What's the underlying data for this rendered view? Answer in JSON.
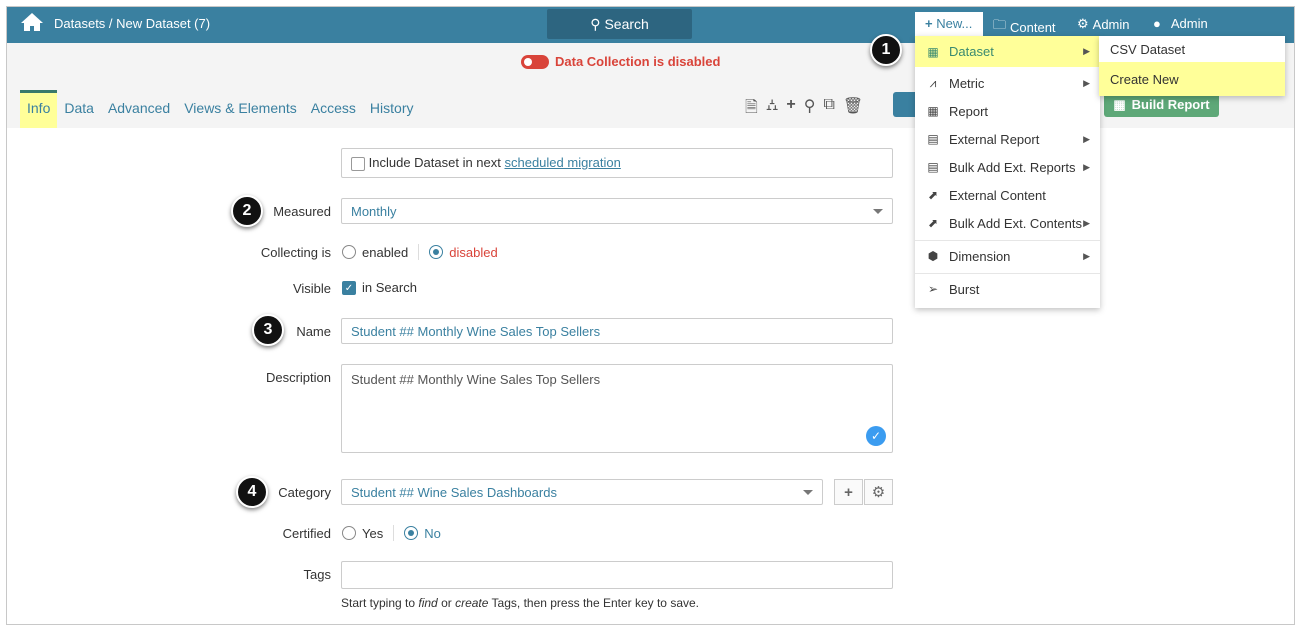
{
  "header": {
    "breadcrumb": "Datasets / New Dataset (7)",
    "search_label": "Search",
    "new_label": "New...",
    "content_label": "Content",
    "admin_label": "Admin",
    "user_label": "Admin"
  },
  "status": {
    "data_collection": "Data Collection is disabled"
  },
  "tabs": [
    {
      "label": "Info"
    },
    {
      "label": "Data"
    },
    {
      "label": "Advanced"
    },
    {
      "label": "Views & Elements"
    },
    {
      "label": "Access"
    },
    {
      "label": "History"
    }
  ],
  "toolbar": {
    "build_report": "Build Report"
  },
  "new_menu": {
    "items": [
      {
        "label": "Dataset"
      },
      {
        "label": "Metric"
      },
      {
        "label": "Report"
      },
      {
        "label": "External Report"
      },
      {
        "label": "Bulk Add Ext. Reports"
      },
      {
        "label": "External Content"
      },
      {
        "label": "Bulk Add Ext. Contents"
      },
      {
        "label": "Dimension"
      },
      {
        "label": "Burst"
      }
    ],
    "submenu": [
      {
        "label": "CSV Dataset"
      },
      {
        "label": "Create New"
      }
    ]
  },
  "form": {
    "migration_text": "Include Dataset in next ",
    "migration_link": "scheduled migration",
    "measured_label": "Measured",
    "measured_value": "Monthly",
    "collecting_label": "Collecting is",
    "enabled": "enabled",
    "disabled": "disabled",
    "visible_label": "Visible",
    "in_search": "in Search",
    "name_label": "Name",
    "name_value": "Student ## Monthly Wine Sales Top Sellers",
    "description_label": "Description",
    "description_value": "Student ## Monthly Wine Sales Top Sellers",
    "category_label": "Category",
    "category_value": "Student ## Wine Sales Dashboards",
    "certified_label": "Certified",
    "yes": "Yes",
    "no": "No",
    "tags_label": "Tags",
    "tags_value": "",
    "hint_1": "Start typing to ",
    "hint_find": "find",
    "hint_2": " or ",
    "hint_create": "create",
    "hint_3": " Tags, then press the Enter key to save."
  },
  "badges": [
    "1",
    "2",
    "3",
    "4"
  ]
}
